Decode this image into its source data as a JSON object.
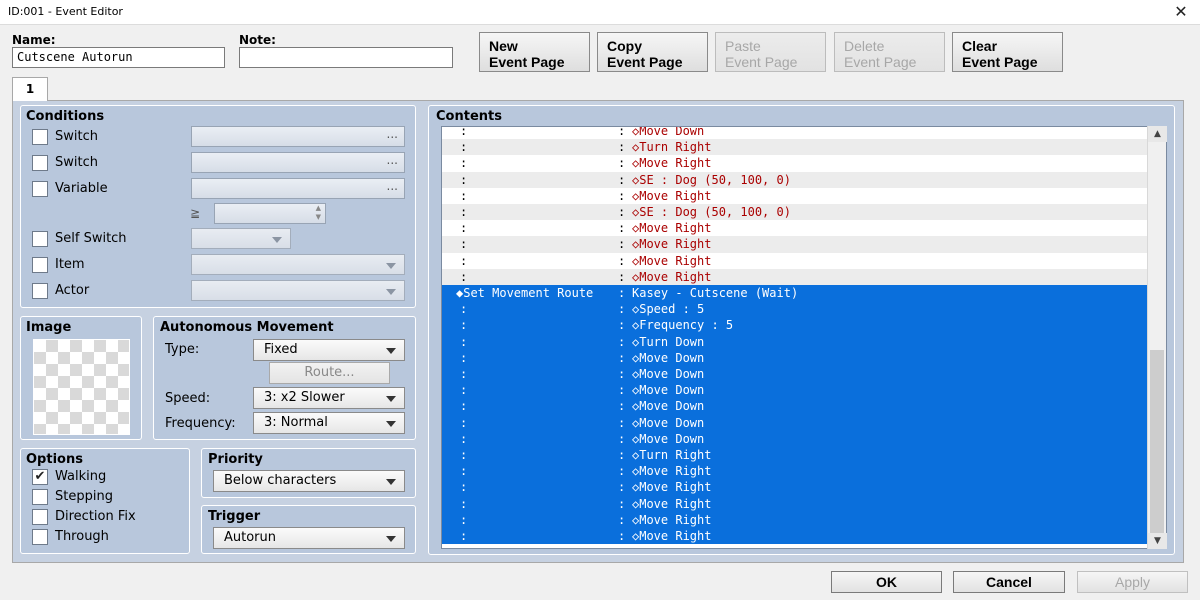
{
  "window": {
    "title": "ID:001 - Event Editor"
  },
  "header": {
    "name_label": "Name:",
    "name_value": "Cutscene Autorun",
    "note_label": "Note:",
    "note_value": ""
  },
  "toolbar": {
    "new_line1": "New",
    "new_line2": "Event Page",
    "copy_line1": "Copy",
    "copy_line2": "Event Page",
    "paste_line1": "Paste",
    "paste_line2": "Event Page",
    "delete_line1": "Delete",
    "delete_line2": "Event Page",
    "clear_line1": "Clear",
    "clear_line2": "Event Page"
  },
  "tabs": [
    "1"
  ],
  "conditions": {
    "title": "Conditions",
    "switch1": "Switch",
    "switch2": "Switch",
    "variable": "Variable",
    "gte": "≧",
    "self_switch": "Self Switch",
    "item": "Item",
    "actor": "Actor",
    "dots": "..."
  },
  "image": {
    "title": "Image"
  },
  "autonomous": {
    "title": "Autonomous Movement",
    "type_label": "Type:",
    "type_value": "Fixed",
    "route_button": "Route...",
    "speed_label": "Speed:",
    "speed_value": "3: x2 Slower",
    "frequency_label": "Frequency:",
    "frequency_value": "3: Normal"
  },
  "options": {
    "title": "Options",
    "walking": "Walking",
    "stepping": "Stepping",
    "direction_fix": "Direction Fix",
    "through": "Through",
    "walking_checked": true
  },
  "priority": {
    "title": "Priority",
    "value": "Below characters"
  },
  "trigger": {
    "title": "Trigger",
    "value": "Autorun"
  },
  "contents": {
    "title": "Contents",
    "rows": [
      {
        "c1": ":",
        "c2": ":",
        "c3": "◇Move Down",
        "sel": false
      },
      {
        "c1": ":",
        "c2": ":",
        "c3": "◇Turn Right",
        "sel": false
      },
      {
        "c1": ":",
        "c2": ":",
        "c3": "◇Move Right",
        "sel": false
      },
      {
        "c1": ":",
        "c2": ":",
        "c3": "◇SE : Dog (50, 100, 0)",
        "sel": false
      },
      {
        "c1": ":",
        "c2": ":",
        "c3": "◇Move Right",
        "sel": false
      },
      {
        "c1": ":",
        "c2": ":",
        "c3": "◇SE : Dog (50, 100, 0)",
        "sel": false
      },
      {
        "c1": ":",
        "c2": ":",
        "c3": "◇Move Right",
        "sel": false
      },
      {
        "c1": ":",
        "c2": ":",
        "c3": "◇Move Right",
        "sel": false
      },
      {
        "c1": ":",
        "c2": ":",
        "c3": "◇Move Right",
        "sel": false
      },
      {
        "c1": ":",
        "c2": ":",
        "c3": "◇Move Right",
        "sel": false
      },
      {
        "c1": "◆Set Movement Route",
        "c2": ":",
        "c3": "Kasey - Cutscene (Wait)",
        "sel": true
      },
      {
        "c1": ":",
        "c2": ":",
        "c3": "◇Speed : 5",
        "sel": true
      },
      {
        "c1": ":",
        "c2": ":",
        "c3": "◇Frequency : 5",
        "sel": true
      },
      {
        "c1": ":",
        "c2": ":",
        "c3": "◇Turn Down",
        "sel": true
      },
      {
        "c1": ":",
        "c2": ":",
        "c3": "◇Move Down",
        "sel": true
      },
      {
        "c1": ":",
        "c2": ":",
        "c3": "◇Move Down",
        "sel": true
      },
      {
        "c1": ":",
        "c2": ":",
        "c3": "◇Move Down",
        "sel": true
      },
      {
        "c1": ":",
        "c2": ":",
        "c3": "◇Move Down",
        "sel": true
      },
      {
        "c1": ":",
        "c2": ":",
        "c3": "◇Move Down",
        "sel": true
      },
      {
        "c1": ":",
        "c2": ":",
        "c3": "◇Move Down",
        "sel": true
      },
      {
        "c1": ":",
        "c2": ":",
        "c3": "◇Turn Right",
        "sel": true
      },
      {
        "c1": ":",
        "c2": ":",
        "c3": "◇Move Right",
        "sel": true
      },
      {
        "c1": ":",
        "c2": ":",
        "c3": "◇Move Right",
        "sel": true
      },
      {
        "c1": ":",
        "c2": ":",
        "c3": "◇Move Right",
        "sel": true
      },
      {
        "c1": ":",
        "c2": ":",
        "c3": "◇Move Right",
        "sel": true
      },
      {
        "c1": ":",
        "c2": ":",
        "c3": "◇Move Right",
        "sel": true
      }
    ]
  },
  "footer": {
    "ok": "OK",
    "cancel": "Cancel",
    "apply": "Apply"
  },
  "colors": {
    "selection": "#0a6fdc",
    "panel": "#b8c7dc",
    "command_text": "#aa0000"
  }
}
